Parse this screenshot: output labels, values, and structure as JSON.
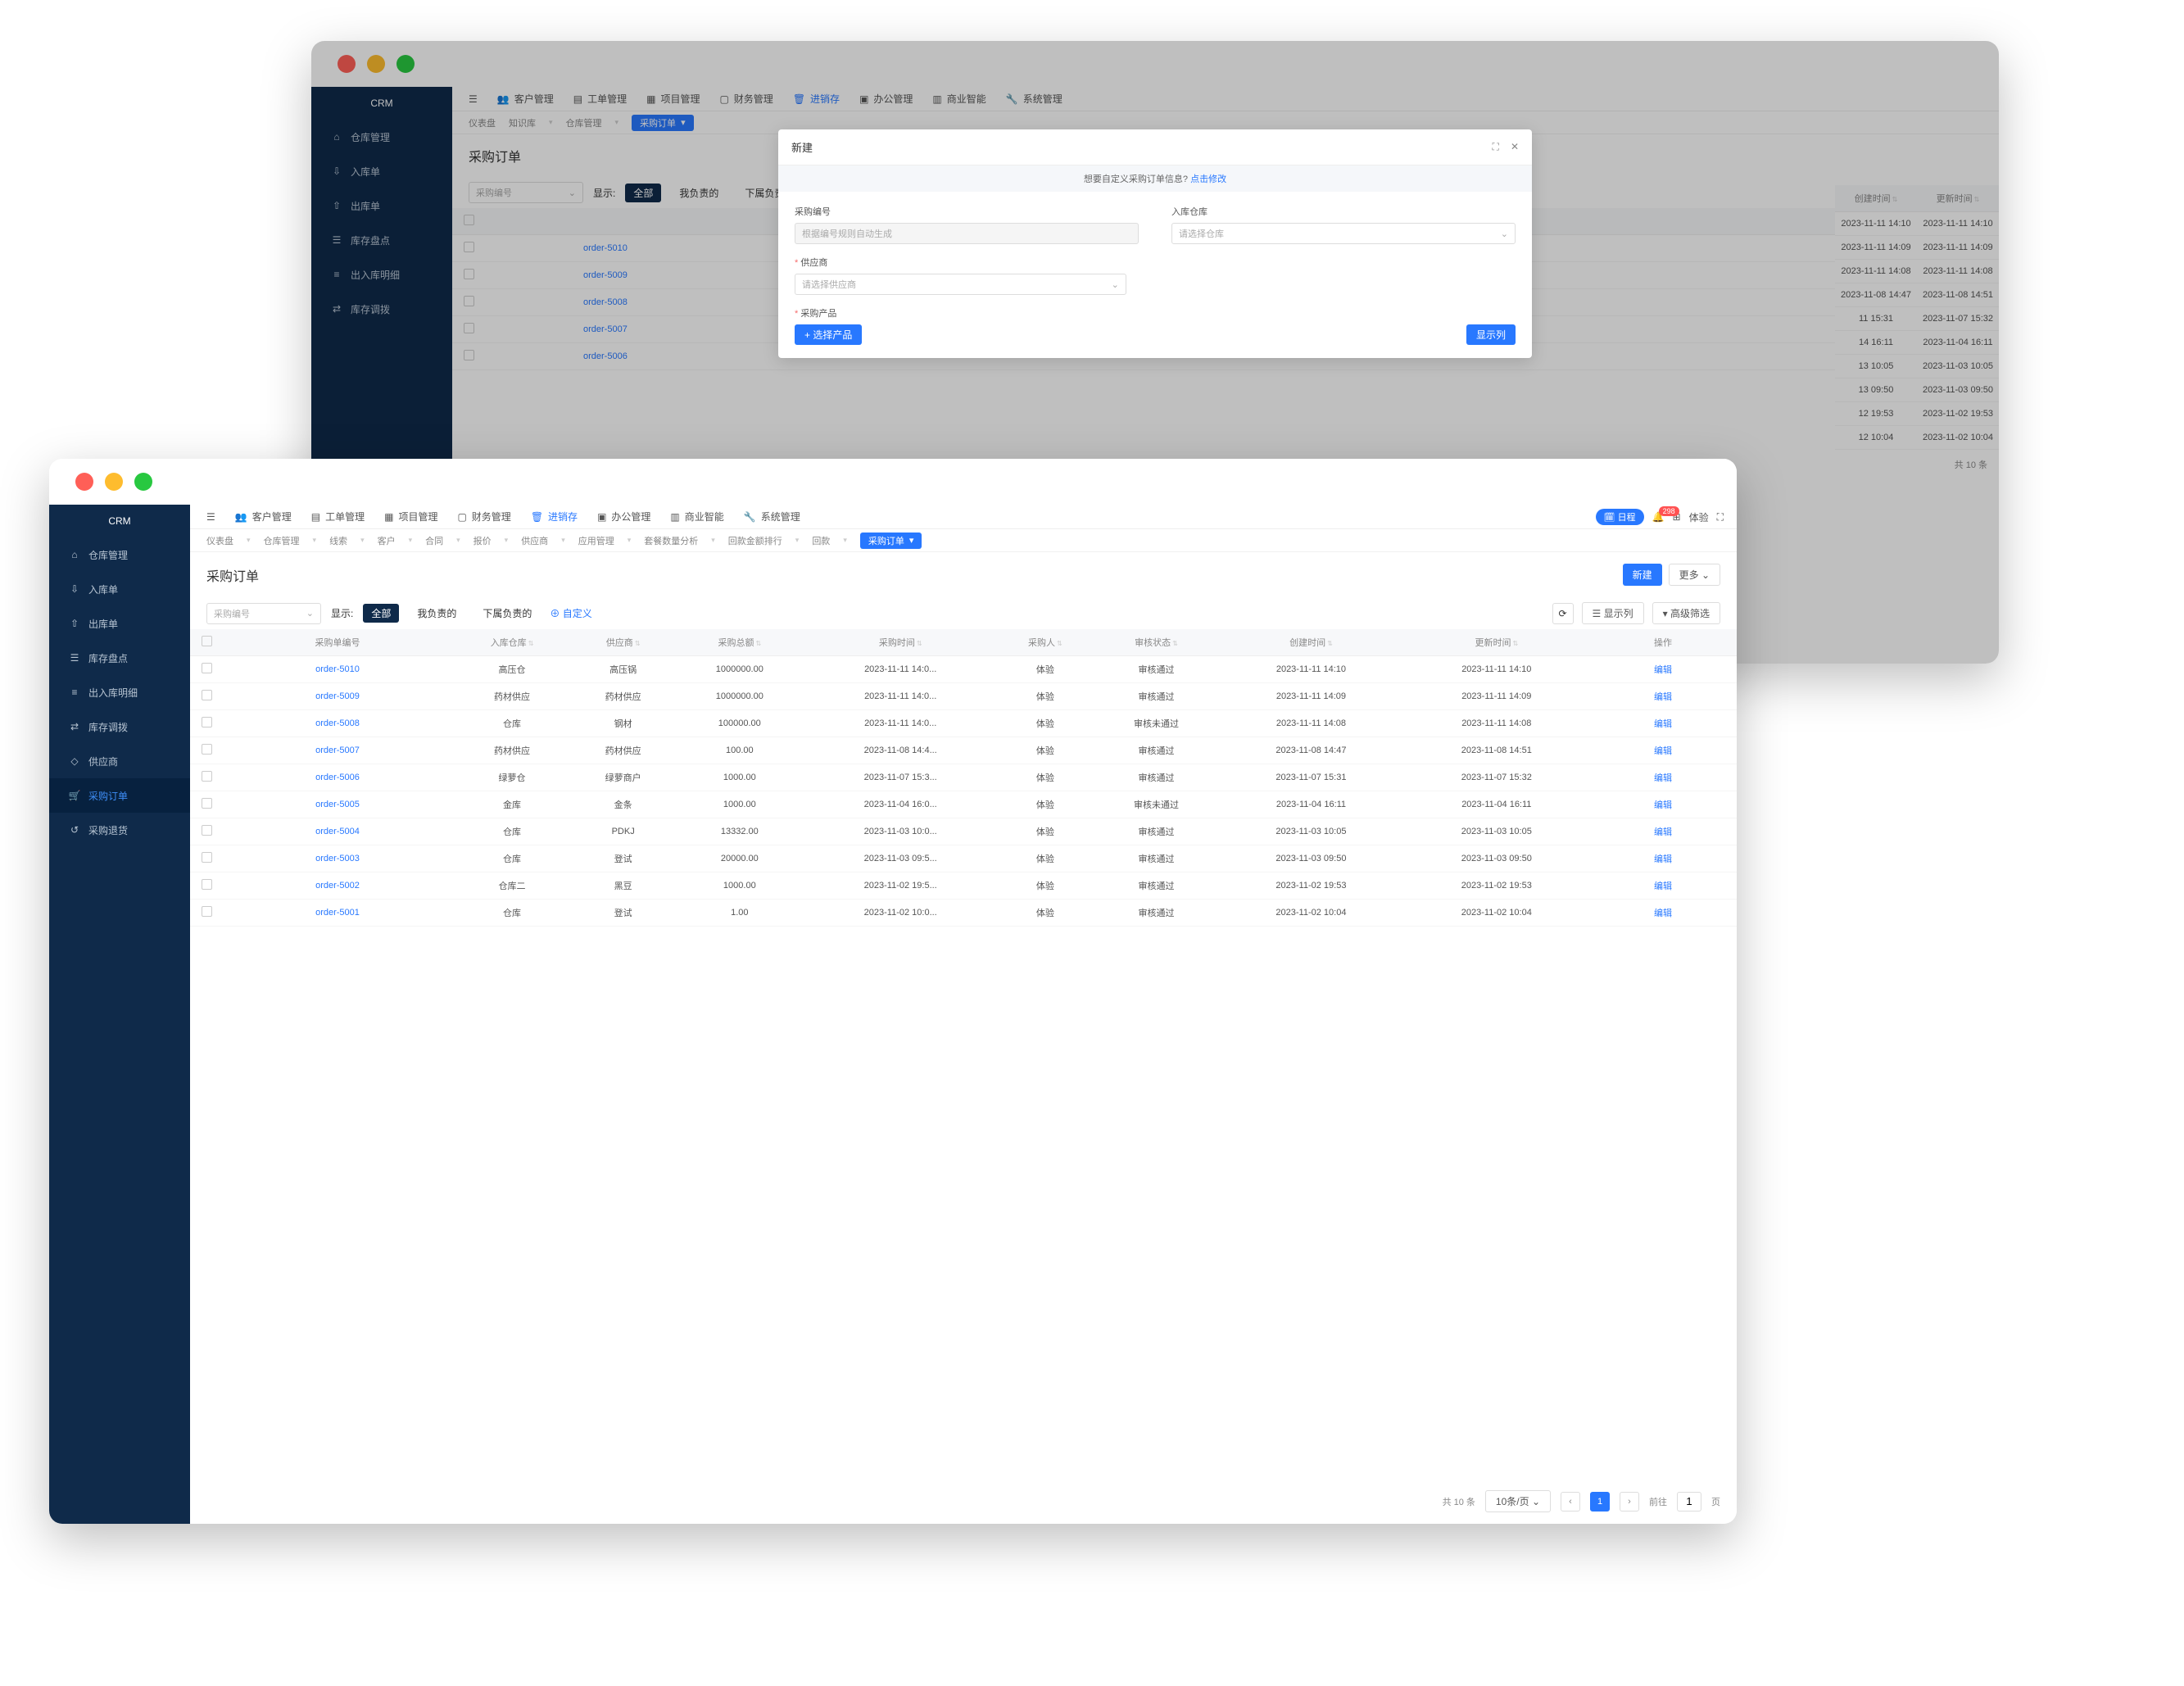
{
  "brand": "CRM",
  "topnav": [
    {
      "label": "客户管理"
    },
    {
      "label": "工单管理"
    },
    {
      "label": "项目管理"
    },
    {
      "label": "财务管理"
    },
    {
      "label": "进销存",
      "active": true
    },
    {
      "label": "办公管理"
    },
    {
      "label": "商业智能"
    },
    {
      "label": "系统管理"
    }
  ],
  "sidebar_back": [
    {
      "label": "仓库管理"
    },
    {
      "label": "入库单"
    },
    {
      "label": "出库单"
    },
    {
      "label": "库存盘点"
    },
    {
      "label": "出入库明细"
    },
    {
      "label": "库存调拨"
    }
  ],
  "sidebar_front": [
    {
      "label": "仓库管理"
    },
    {
      "label": "入库单"
    },
    {
      "label": "出库单"
    },
    {
      "label": "库存盘点"
    },
    {
      "label": "出入库明细"
    },
    {
      "label": "库存调拨"
    },
    {
      "label": "供应商"
    },
    {
      "label": "采购订单",
      "active": true
    },
    {
      "label": "采购退货"
    }
  ],
  "breadcrumb_back": [
    {
      "label": "仪表盘"
    },
    {
      "label": "知识库"
    },
    {
      "label": "仓库管理"
    }
  ],
  "breadcrumb_back_tag": "采购订单",
  "breadcrumb_front": [
    {
      "label": "仪表盘"
    },
    {
      "label": "仓库管理"
    },
    {
      "label": "线索"
    },
    {
      "label": "客户"
    },
    {
      "label": "合同"
    },
    {
      "label": "报价"
    },
    {
      "label": "供应商"
    },
    {
      "label": "应用管理"
    },
    {
      "label": "套餐数量分析"
    },
    {
      "label": "回款金额排行"
    },
    {
      "label": "回款"
    }
  ],
  "breadcrumb_front_tag": "采购订单",
  "page_title": "采购订单",
  "search_placeholder": "采购编号",
  "display_label": "显示:",
  "tabs": [
    "全部",
    "我负责的",
    "下属负责的"
  ],
  "custom_link": "自定义",
  "btn_new": "新建",
  "btn_more": "更多",
  "btn_show_cols": "显示列",
  "btn_adv_filter": "高级筛选",
  "pill_calendar": "日程",
  "badge_count": "298",
  "user_name": "体验",
  "columns": [
    "",
    "采购单编号",
    "入库仓库",
    "供应商",
    "采购总额",
    "采购时间",
    "采购人",
    "审核状态",
    "创建时间",
    "更新时间",
    "操作"
  ],
  "edit_label": "编辑",
  "rows": [
    {
      "id": "order-5010",
      "wh": "高压仓",
      "sup": "高压锅",
      "amt": "1000000.00",
      "time": "2023-11-11 14:0...",
      "buyer": "体验",
      "status": "审核通过",
      "ok": true,
      "ct": "2023-11-11 14:10",
      "ut": "2023-11-11 14:10"
    },
    {
      "id": "order-5009",
      "wh": "药材供应",
      "sup": "药材供应",
      "amt": "1000000.00",
      "time": "2023-11-11 14:0...",
      "buyer": "体验",
      "status": "审核通过",
      "ok": true,
      "ct": "2023-11-11 14:09",
      "ut": "2023-11-11 14:09"
    },
    {
      "id": "order-5008",
      "wh": "仓库",
      "sup": "钢材",
      "amt": "100000.00",
      "time": "2023-11-11 14:0...",
      "buyer": "体验",
      "status": "审核未通过",
      "ok": false,
      "ct": "2023-11-11 14:08",
      "ut": "2023-11-11 14:08"
    },
    {
      "id": "order-5007",
      "wh": "药材供应",
      "sup": "药材供应",
      "amt": "100.00",
      "time": "2023-11-08 14:4...",
      "buyer": "体验",
      "status": "审核通过",
      "ok": true,
      "ct": "2023-11-08 14:47",
      "ut": "2023-11-08 14:51"
    },
    {
      "id": "order-5006",
      "wh": "绿萝仓",
      "sup": "绿萝商户",
      "amt": "1000.00",
      "time": "2023-11-07 15:3...",
      "buyer": "体验",
      "status": "审核通过",
      "ok": true,
      "ct": "2023-11-07 15:31",
      "ut": "2023-11-07 15:32"
    },
    {
      "id": "order-5005",
      "wh": "金库",
      "sup": "金条",
      "amt": "1000.00",
      "time": "2023-11-04 16:0...",
      "buyer": "体验",
      "status": "审核未通过",
      "ok": false,
      "ct": "2023-11-04 16:11",
      "ut": "2023-11-04 16:11"
    },
    {
      "id": "order-5004",
      "wh": "仓库",
      "sup": "PDKJ",
      "amt": "13332.00",
      "time": "2023-11-03 10:0...",
      "buyer": "体验",
      "status": "审核通过",
      "ok": true,
      "ct": "2023-11-03 10:05",
      "ut": "2023-11-03 10:05"
    },
    {
      "id": "order-5003",
      "wh": "仓库",
      "sup": "登试",
      "amt": "20000.00",
      "time": "2023-11-03 09:5...",
      "buyer": "体验",
      "status": "审核通过",
      "ok": true,
      "ct": "2023-11-03 09:50",
      "ut": "2023-11-03 09:50"
    },
    {
      "id": "order-5002",
      "wh": "仓库二",
      "sup": "黑豆",
      "amt": "1000.00",
      "time": "2023-11-02 19:5...",
      "buyer": "体验",
      "status": "审核通过",
      "ok": true,
      "ct": "2023-11-02 19:53",
      "ut": "2023-11-02 19:53"
    },
    {
      "id": "order-5001",
      "wh": "仓库",
      "sup": "登试",
      "amt": "1.00",
      "time": "2023-11-02 10:0...",
      "buyer": "体验",
      "status": "审核通过",
      "ok": true,
      "ct": "2023-11-02 10:04",
      "ut": "2023-11-02 10:04"
    }
  ],
  "back_rows_extra": [
    {
      "ct": "2023-11-11 14:10",
      "ut": "2023-11-11 14:10"
    },
    {
      "ct": "2023-11-11 14:09",
      "ut": "2023-11-11 14:09"
    },
    {
      "ct": "2023-11-11 14:08",
      "ut": "2023-11-11 14:08"
    },
    {
      "ct": "2023-11-08 14:47",
      "ut": "2023-11-08 14:51"
    },
    {
      "ct": "11 15:31",
      "ut": "2023-11-07 15:32"
    },
    {
      "ct": "14 16:11",
      "ut": "2023-11-04 16:11"
    },
    {
      "ct": "13 10:05",
      "ut": "2023-11-03 10:05"
    },
    {
      "ct": "13 09:50",
      "ut": "2023-11-03 09:50"
    },
    {
      "ct": "12 19:53",
      "ut": "2023-11-02 19:53"
    },
    {
      "ct": "12 10:04",
      "ut": "2023-11-02 10:04"
    }
  ],
  "pager": {
    "total_label": "共 10 条",
    "page_size": "10条/页",
    "current": "1",
    "goto_label": "前往",
    "goto_val": "1",
    "page_suffix": "页",
    "back_total": "共 10 条"
  },
  "modal": {
    "title": "新建",
    "banner_q": "想要自定义采购订单信息?",
    "banner_link": "点击修改",
    "f_code_label": "采购编号",
    "f_code_ph": "根据编号规则自动生成",
    "f_wh_label": "入库仓库",
    "f_wh_ph": "请选择仓库",
    "f_sup_label": "供应商",
    "f_sup_ph": "请选择供应商",
    "f_prod_label": "采购产品",
    "btn_pick": "+ 选择产品",
    "btn_cols": "显示列"
  }
}
